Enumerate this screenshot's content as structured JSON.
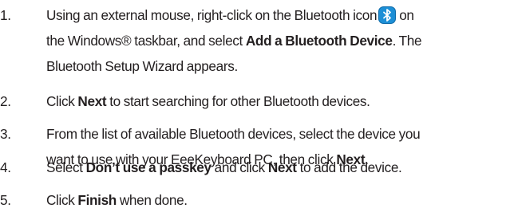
{
  "colors": {
    "text": "#231f20",
    "bluetooth_icon_bg": "#1d8fd6"
  },
  "steps": [
    {
      "number": "1.",
      "line1_prefix": "Using an external mouse, right-click on the Bluetooth icon",
      "line1_suffix": "on",
      "line2_prefix": "the Windows® taskbar, and select ",
      "line2_bold": "Add a Bluetooth Device",
      "line2_suffix": ". The",
      "line3": "Bluetooth Setup Wizard appears.",
      "icon": "bluetooth-icon"
    },
    {
      "number": "2.",
      "prefix": "Click ",
      "bold": "Next",
      "suffix": " to start searching for other Bluetooth devices."
    },
    {
      "number": "3.",
      "line1": "From the list of available Bluetooth devices, select the device you",
      "line2_prefix": "want to use with your EeeKeyboard PC, then click ",
      "line2_bold": "Next",
      "line2_suffix": "."
    },
    {
      "number": "4.",
      "prefix": "Select ",
      "bold1": "Don’t use a passkey",
      "middle": " and click ",
      "bold2": "Next",
      "suffix": " to add the device."
    },
    {
      "number": "5.",
      "prefix": "Click ",
      "bold": "Finish",
      "suffix": " when done."
    }
  ]
}
